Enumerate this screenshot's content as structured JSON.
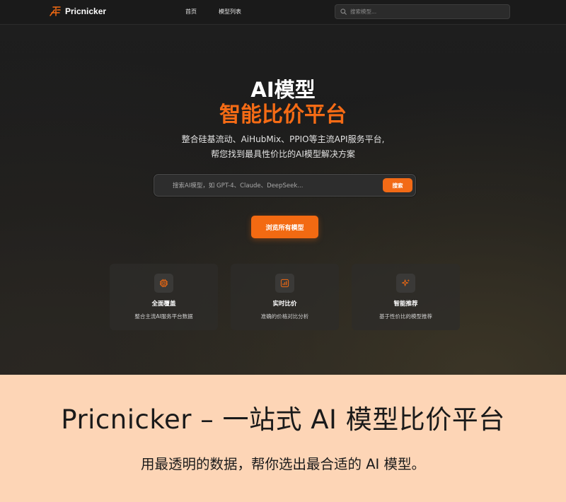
{
  "nav": {
    "brand": "Pricnicker",
    "logo_icon": "pricnicker-logo-icon",
    "links": [
      "首页",
      "模型列表"
    ],
    "search_placeholder": "搜索模型..."
  },
  "hero": {
    "title_line1": "AI模型",
    "title_line2": "智能比价平台",
    "subtitle_line1": "整合硅基流动、AiHubMix、PPIO等主流API服务平台,",
    "subtitle_line2": "帮您找到最具性价比的AI模型解决方案",
    "search_placeholder": "搜索AI模型，如 GPT-4、Claude、DeepSeek...",
    "search_button": "搜索",
    "browse_button": "浏览所有模型"
  },
  "features": [
    {
      "icon": "chip-icon",
      "title": "全面覆盖",
      "desc": "整合主流AI服务平台数据"
    },
    {
      "icon": "bar-chart-icon",
      "title": "实时比价",
      "desc": "准确的价格对比分析"
    },
    {
      "icon": "sparkle-icon",
      "title": "智能推荐",
      "desc": "基于性价比的模型推荐"
    }
  ],
  "banner": {
    "title": "Pricnicker – 一站式 AI 模型比价平台",
    "subtitle": "用最透明的数据，帮你选出最合适的 AI 模型。"
  },
  "colors": {
    "accent": "#f36a12",
    "banner_bg": "#fdd5b6",
    "hero_bg": "#1c1c1c"
  }
}
